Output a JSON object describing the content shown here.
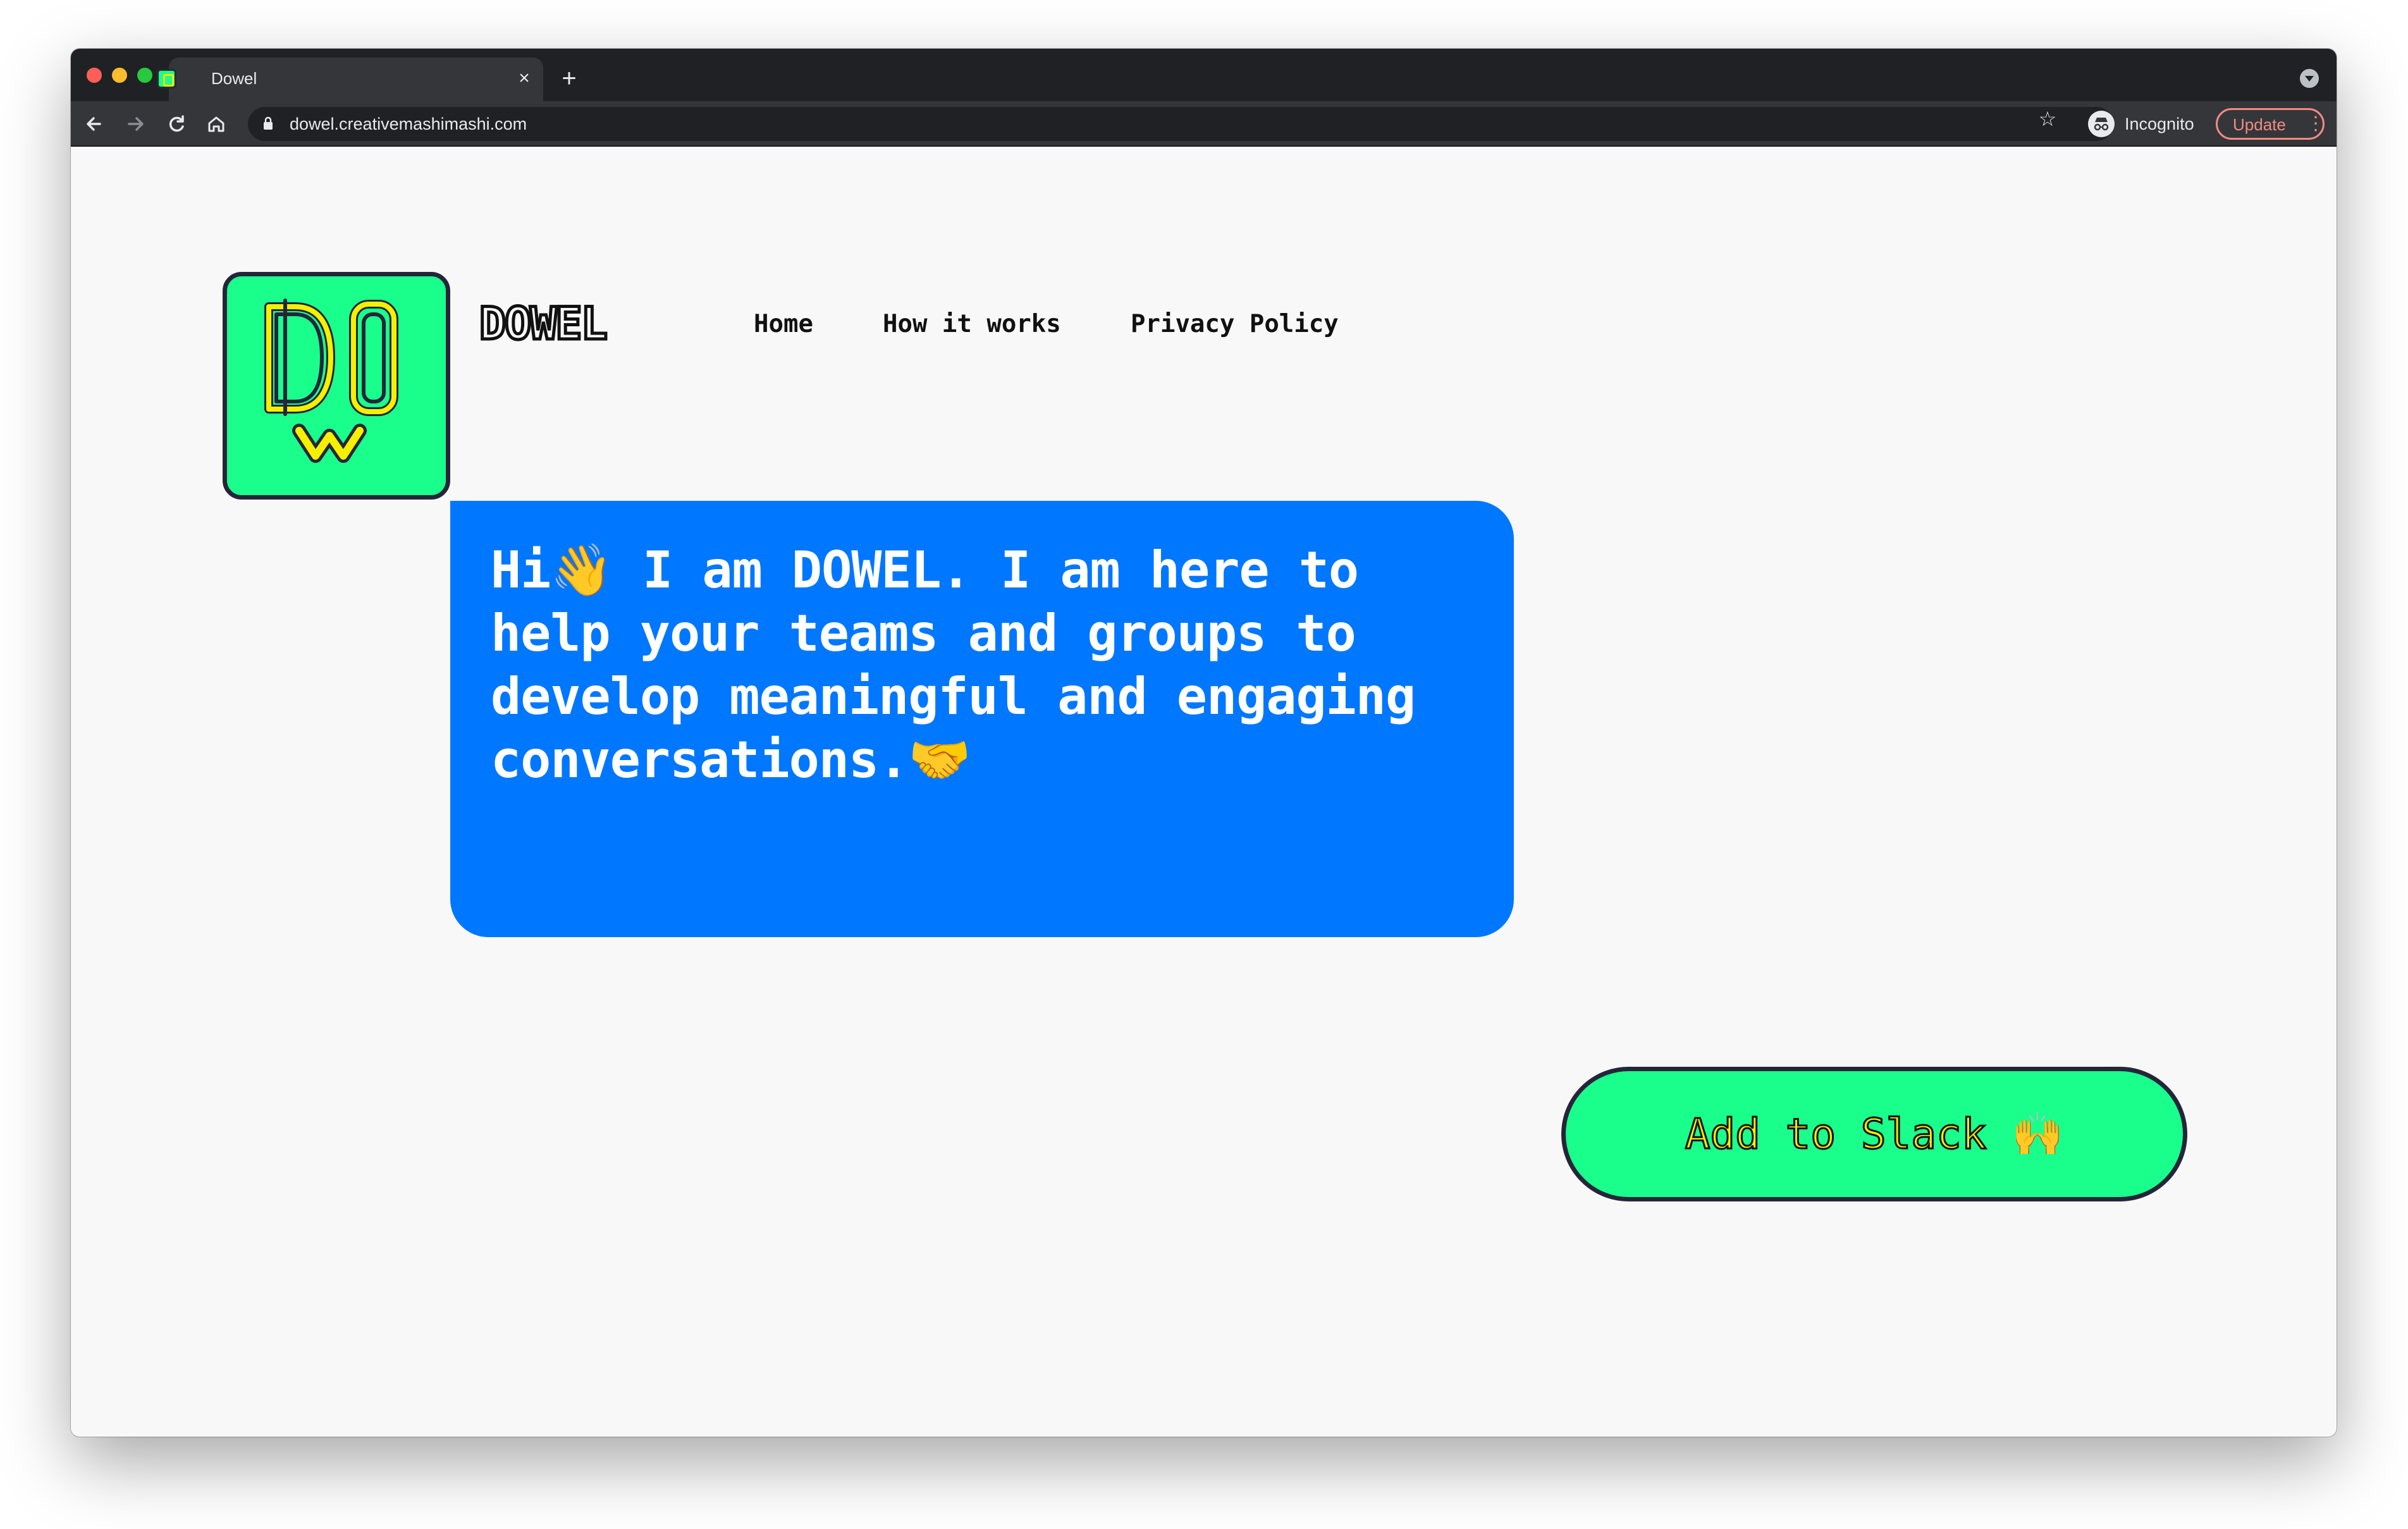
{
  "browser": {
    "tab_title": "Dowel",
    "tab_close": "×",
    "new_tab": "+",
    "url": "dowel.creativemashimashi.com",
    "profile_label": "Incognito",
    "update_label": "Update",
    "update_menu": "⋮",
    "star": "☆"
  },
  "header": {
    "brand": "DOWEL",
    "nav": {
      "home": "Home",
      "how_it_works": "How it works",
      "privacy_policy": "Privacy Policy"
    }
  },
  "hero": {
    "message": "Hi👋 I am DOWEL. I am here to help your teams and groups to develop meaningful and engaging conversations.🤝"
  },
  "cta": {
    "label": "Add to Slack 🙌"
  },
  "colors": {
    "brand_green": "#1aff8c",
    "brand_yellow": "#f4f000",
    "bubble_blue": "#0077ff",
    "outline": "#25253a",
    "page_bg": "#f8f8f8"
  },
  "icons": [
    "back-icon",
    "forward-icon",
    "reload-icon",
    "home-icon",
    "lock-icon",
    "star-icon",
    "incognito-icon",
    "tab-search-icon"
  ]
}
